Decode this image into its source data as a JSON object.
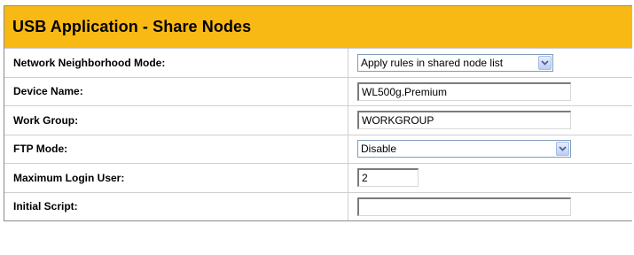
{
  "header": {
    "title": "USB Application - Share Nodes"
  },
  "colors": {
    "header_bg": "#f9b915",
    "select_arrow": "#4d6185"
  },
  "fields": {
    "network_mode": {
      "label": "Network Neighborhood Mode:",
      "value": "Apply rules in shared node list"
    },
    "device_name": {
      "label": "Device Name:",
      "value": "WL500g.Premium"
    },
    "work_group": {
      "label": "Work Group:",
      "value": "WORKGROUP"
    },
    "ftp_mode": {
      "label": "FTP Mode:",
      "value": "Disable"
    },
    "max_login": {
      "label": "Maximum Login User:",
      "value": "2"
    },
    "initial_script": {
      "label": "Initial Script:",
      "value": ""
    }
  }
}
